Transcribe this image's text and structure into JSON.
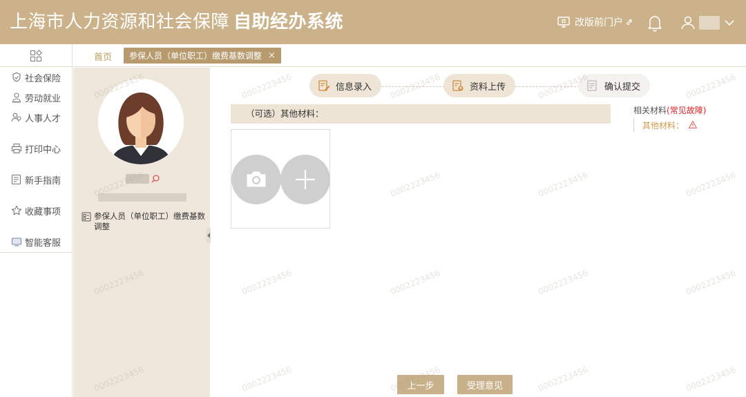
{
  "header": {
    "title_main": "上海市人力资源和社会保障",
    "title_system": "自助经办系统",
    "portal_link": "改版前门户",
    "icons": {
      "portal": "monitor-icon",
      "link": "link-icon",
      "bell": "bell-icon",
      "user": "user-icon",
      "chevron": "chevron-down-icon"
    }
  },
  "tabs": {
    "home": "首页",
    "active": "参保人员（单位职工）缴费基数调整",
    "close": "×"
  },
  "nav": {
    "items": [
      {
        "label": "社会保险",
        "icon": "shield-hand-icon"
      },
      {
        "label": "劳动就业",
        "icon": "worker-icon"
      },
      {
        "label": "人事人才",
        "icon": "people-icon"
      },
      {
        "label": "打印中心",
        "icon": "printer-icon"
      },
      {
        "label": "新手指南",
        "icon": "guide-icon"
      },
      {
        "label": "收藏事项",
        "icon": "star-icon"
      },
      {
        "label": "智能客服",
        "icon": "service-icon"
      }
    ]
  },
  "profile": {
    "business_item": "参保人员（单位职工）缴费基数调整"
  },
  "steps": [
    {
      "label": "信息录入",
      "state": "done"
    },
    {
      "label": "资料上传",
      "state": "done"
    },
    {
      "label": "确认提交",
      "state": "todo"
    }
  ],
  "materials": {
    "section_title": "（可选）其他材料：",
    "related_label": "相关材料",
    "related_link": "(常见故障)",
    "related_item": "其他材料："
  },
  "footer": {
    "prev": "上一步",
    "opinion": "受理意见"
  },
  "watermark": "0002223456",
  "colors": {
    "header_bg": "#cbb28a",
    "accent": "#b79a6e",
    "panel_bg": "#efe7dc",
    "link_red": "#dd2222",
    "material_orange": "#d39a4e"
  }
}
